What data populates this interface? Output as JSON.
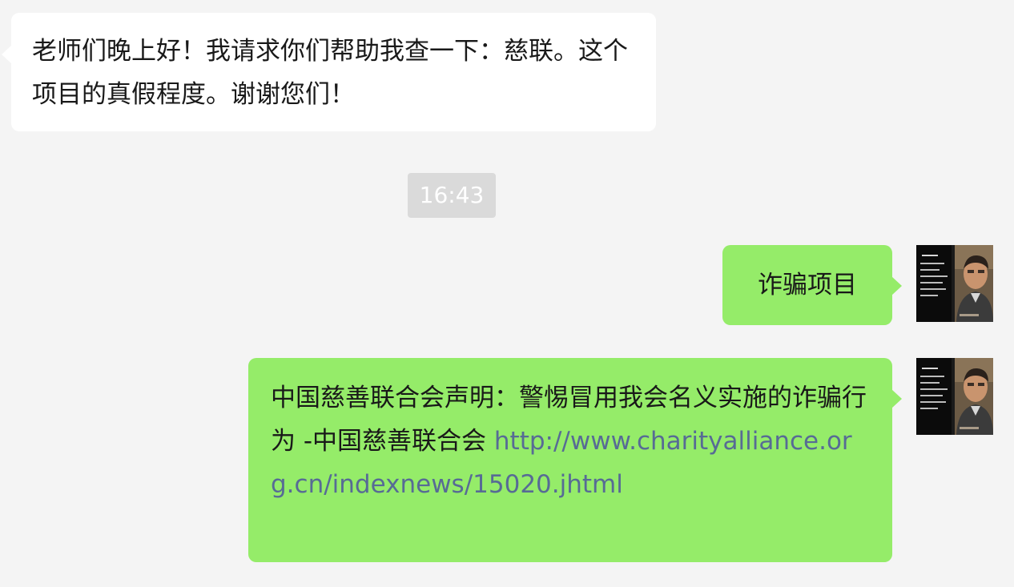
{
  "chat": {
    "messages": [
      {
        "sender": "other",
        "text": "老师们晚上好！我请求你们帮助我查一下：慈联。这个项目的真假程度。谢谢您们！"
      },
      {
        "sender": "self",
        "text": "诈骗项目"
      },
      {
        "sender": "self",
        "text": "中国慈善联合会声明：警惕冒用我会名义实施的诈骗行为 -中国慈善联合会 ",
        "link": "http://www.charityalliance.org.cn/indexnews/15020.jhtml"
      }
    ],
    "timestamp": "16:43"
  },
  "colors": {
    "background": "#f4f4f4",
    "incoming_bubble": "#ffffff",
    "outgoing_bubble": "#95ec69",
    "link": "#576b95",
    "timestamp_badge": "#dadada"
  },
  "icons": {
    "avatar": "user-photo-avatar"
  }
}
